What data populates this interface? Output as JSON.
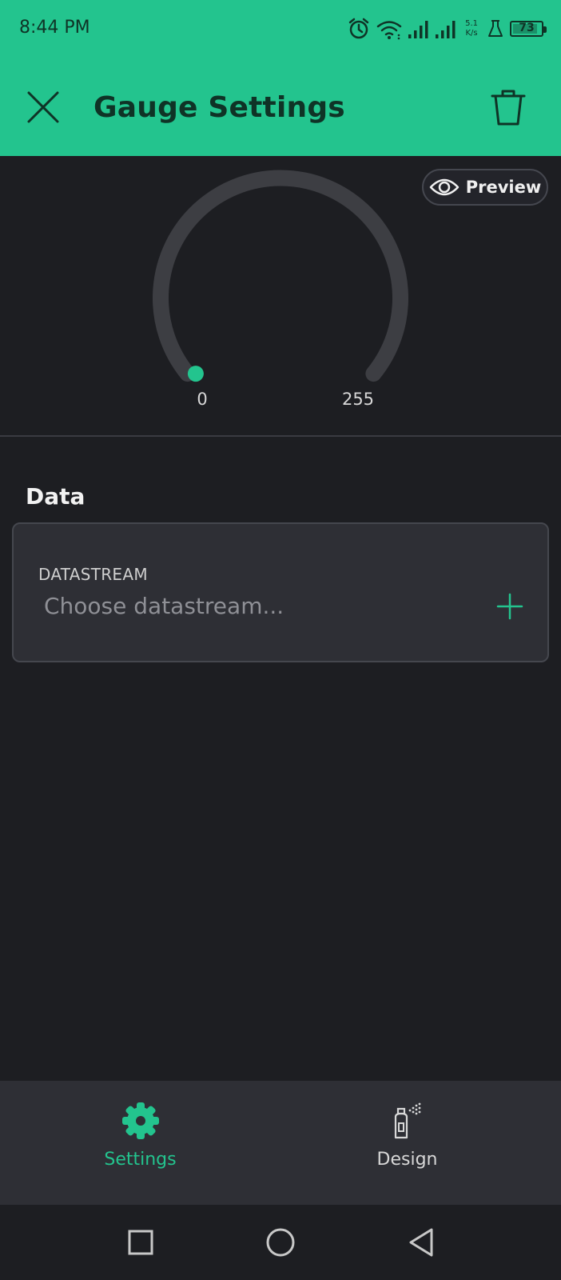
{
  "status_bar": {
    "time": "8:44 PM",
    "speed_value": "5.1",
    "speed_unit": "K/s",
    "battery": "73",
    "icons": [
      "alarm-icon",
      "wifi-icon",
      "signal-icon",
      "signal-icon",
      "flask-icon",
      "battery-icon"
    ]
  },
  "header": {
    "title": "Gauge Settings",
    "close_icon": "close-icon",
    "delete_icon": "trash-icon"
  },
  "preview": {
    "button_label": "Preview",
    "icon": "eye-icon",
    "gauge_min": "0",
    "gauge_max": "255",
    "gauge_value_fraction": 0
  },
  "data_section": {
    "title": "Data",
    "datastream_label": "DATASTREAM",
    "datastream_placeholder": "Choose datastream...",
    "datastream_value": "",
    "add_icon": "plus-icon"
  },
  "bottom_nav": {
    "tabs": [
      {
        "label": "Settings",
        "icon": "gear-icon",
        "active": true
      },
      {
        "label": "Design",
        "icon": "spray-can-icon",
        "active": false
      }
    ]
  },
  "system_nav": [
    "recents-square-icon",
    "home-circle-icon",
    "back-triangle-icon"
  ],
  "colors": {
    "accent": "#23c48e",
    "background": "#1d1e22",
    "card": "#2e2f35",
    "gauge_track": "#3d3e43"
  }
}
